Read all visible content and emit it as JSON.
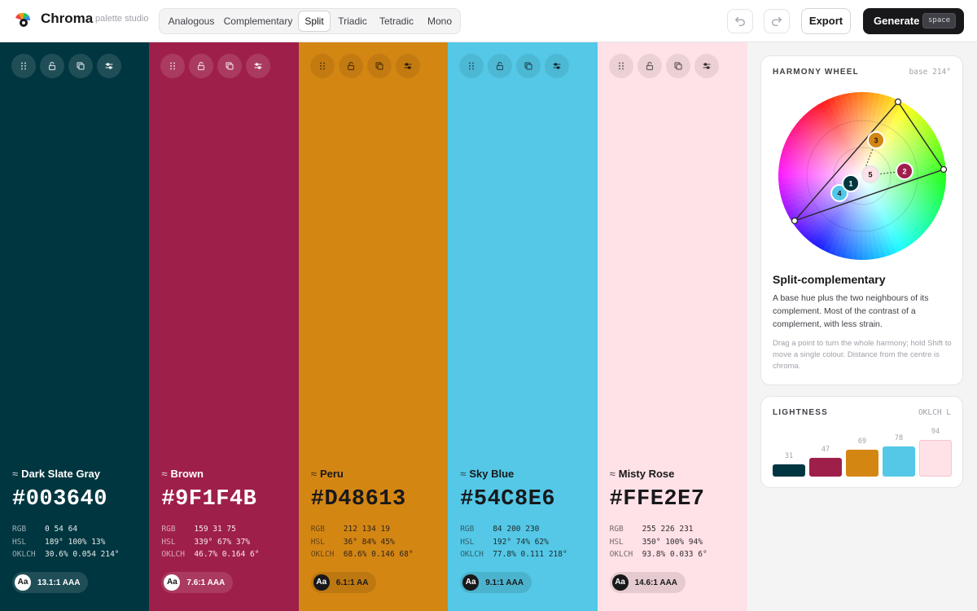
{
  "app": {
    "name": "Chroma",
    "subtitle": "palette studio"
  },
  "modes": [
    {
      "label": "Analogous",
      "active": false
    },
    {
      "label": "Complementary",
      "active": false
    },
    {
      "label": "Split",
      "active": true
    },
    {
      "label": "Triadic",
      "active": false
    },
    {
      "label": "Tetradic",
      "active": false
    },
    {
      "label": "Mono",
      "active": false
    }
  ],
  "toolbar": {
    "undo_icon": "undo-icon",
    "redo_icon": "redo-icon",
    "export_label": "Export",
    "generate_label": "Generate",
    "generate_kbd": "space"
  },
  "swatch_tools": [
    "drag-handle-icon",
    "unlock-icon",
    "copy-icon",
    "adjust-sliders-icon"
  ],
  "swatches": [
    {
      "name": "Dark Slate Gray",
      "hex": "#003640",
      "bg": "#003640",
      "fg": "#ffffff",
      "rgb": "0 54 64",
      "hsl": "189° 100% 13%",
      "oklch": "30.6% 0.054 214°",
      "contrast": "13.1:1 AAA"
    },
    {
      "name": "Brown",
      "hex": "#9F1F4B",
      "bg": "#9f1f4b",
      "fg": "#ffffff",
      "rgb": "159 31 75",
      "hsl": "339° 67% 37%",
      "oklch": "46.7% 0.164 6°",
      "contrast": "7.6:1 AAA"
    },
    {
      "name": "Peru",
      "hex": "#D48613",
      "bg": "#d48613",
      "fg": "#18181b",
      "rgb": "212 134 19",
      "hsl": "36° 84% 45%",
      "oklch": "68.6% 0.146 68°",
      "contrast": "6.1:1 AA"
    },
    {
      "name": "Sky Blue",
      "hex": "#54C8E6",
      "bg": "#54c8e6",
      "fg": "#18181b",
      "rgb": "84 200 230",
      "hsl": "192° 74% 62%",
      "oklch": "77.8% 0.111 218°",
      "contrast": "9.1:1 AAA"
    },
    {
      "name": "Misty Rose",
      "hex": "#FFE2E7",
      "bg": "#ffe2e7",
      "fg": "#18181b",
      "rgb": "255 226 231",
      "hsl": "350° 100% 94%",
      "oklch": "93.8% 0.033 6°",
      "contrast": "14.6:1 AAA"
    }
  ],
  "harmony": {
    "panel_title": "HARMONY WHEEL",
    "base_label": "base 214°",
    "title": "Split-complementary",
    "description": "A base hue plus the two neighbours of its complement. Most of the contrast of a complement, with less strain.",
    "hint": "Drag a point to turn the whole harmony; hold Shift to move a single colour. Distance from the centre is chroma.",
    "points": [
      {
        "label": "1",
        "color": "#003640",
        "text_color": "#ffffff"
      },
      {
        "label": "2",
        "color": "#9f1f4b",
        "text_color": "#ffffff"
      },
      {
        "label": "3",
        "color": "#d48613",
        "text_color": "#18181b"
      },
      {
        "label": "4",
        "color": "#54c8e6",
        "text_color": "#18181b"
      },
      {
        "label": "5",
        "color": "#ffe2e7",
        "text_color": "#18181b"
      }
    ]
  },
  "lightness": {
    "panel_title": "LIGHTNESS",
    "unit_label": "OKLCH L",
    "values": [
      31,
      47,
      69,
      78,
      94
    ],
    "colors": [
      "#003640",
      "#9f1f4b",
      "#d48613",
      "#54c8e6",
      "#ffe2e7"
    ]
  }
}
